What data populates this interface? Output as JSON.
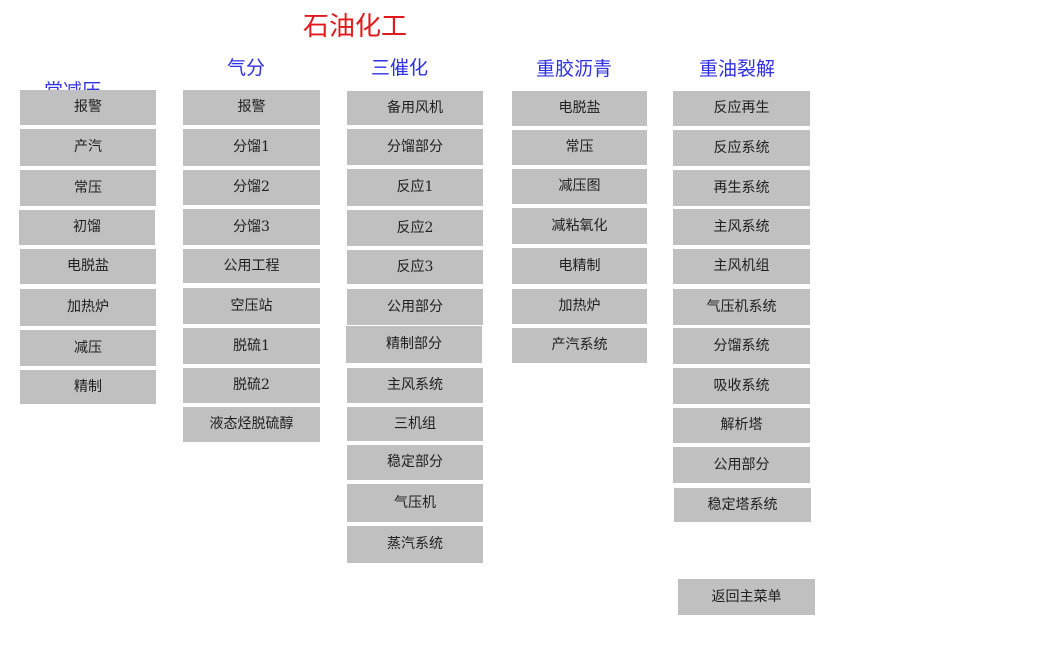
{
  "title": "石油化工",
  "columns": [
    {
      "title": "常减压",
      "items": [
        "报警",
        "产汽",
        "常压",
        "初馏",
        "电脱盐",
        "加热炉",
        "减压",
        "精制"
      ]
    },
    {
      "title": "气分",
      "items": [
        "报警",
        "分馏1",
        "分馏2",
        "分馏3",
        "公用工程",
        "空压站",
        "脱硫1",
        "脱硫2",
        "液态烃脱硫醇"
      ]
    },
    {
      "title": "三催化",
      "items": [
        "备用风机",
        "分馏部分",
        "反应1",
        "反应2",
        "反应3",
        "公用部分",
        "精制部分",
        "主风系统",
        "三机组",
        "稳定部分",
        "气压机",
        "蒸汽系统"
      ]
    },
    {
      "title": "重胶沥青",
      "items": [
        "电脱盐",
        "常压",
        "减压图",
        "减粘氧化",
        "电精制",
        "加热炉",
        "产汽系统"
      ]
    },
    {
      "title": "重油裂解",
      "items": [
        "反应再生",
        "反应系统",
        "再生系统",
        "主风系统",
        "主风机组",
        "气压机系统",
        "分馏系统",
        "吸收系统",
        "解析塔",
        "公用部分",
        "稳定塔系统"
      ]
    }
  ],
  "return_button": "返回主菜单"
}
